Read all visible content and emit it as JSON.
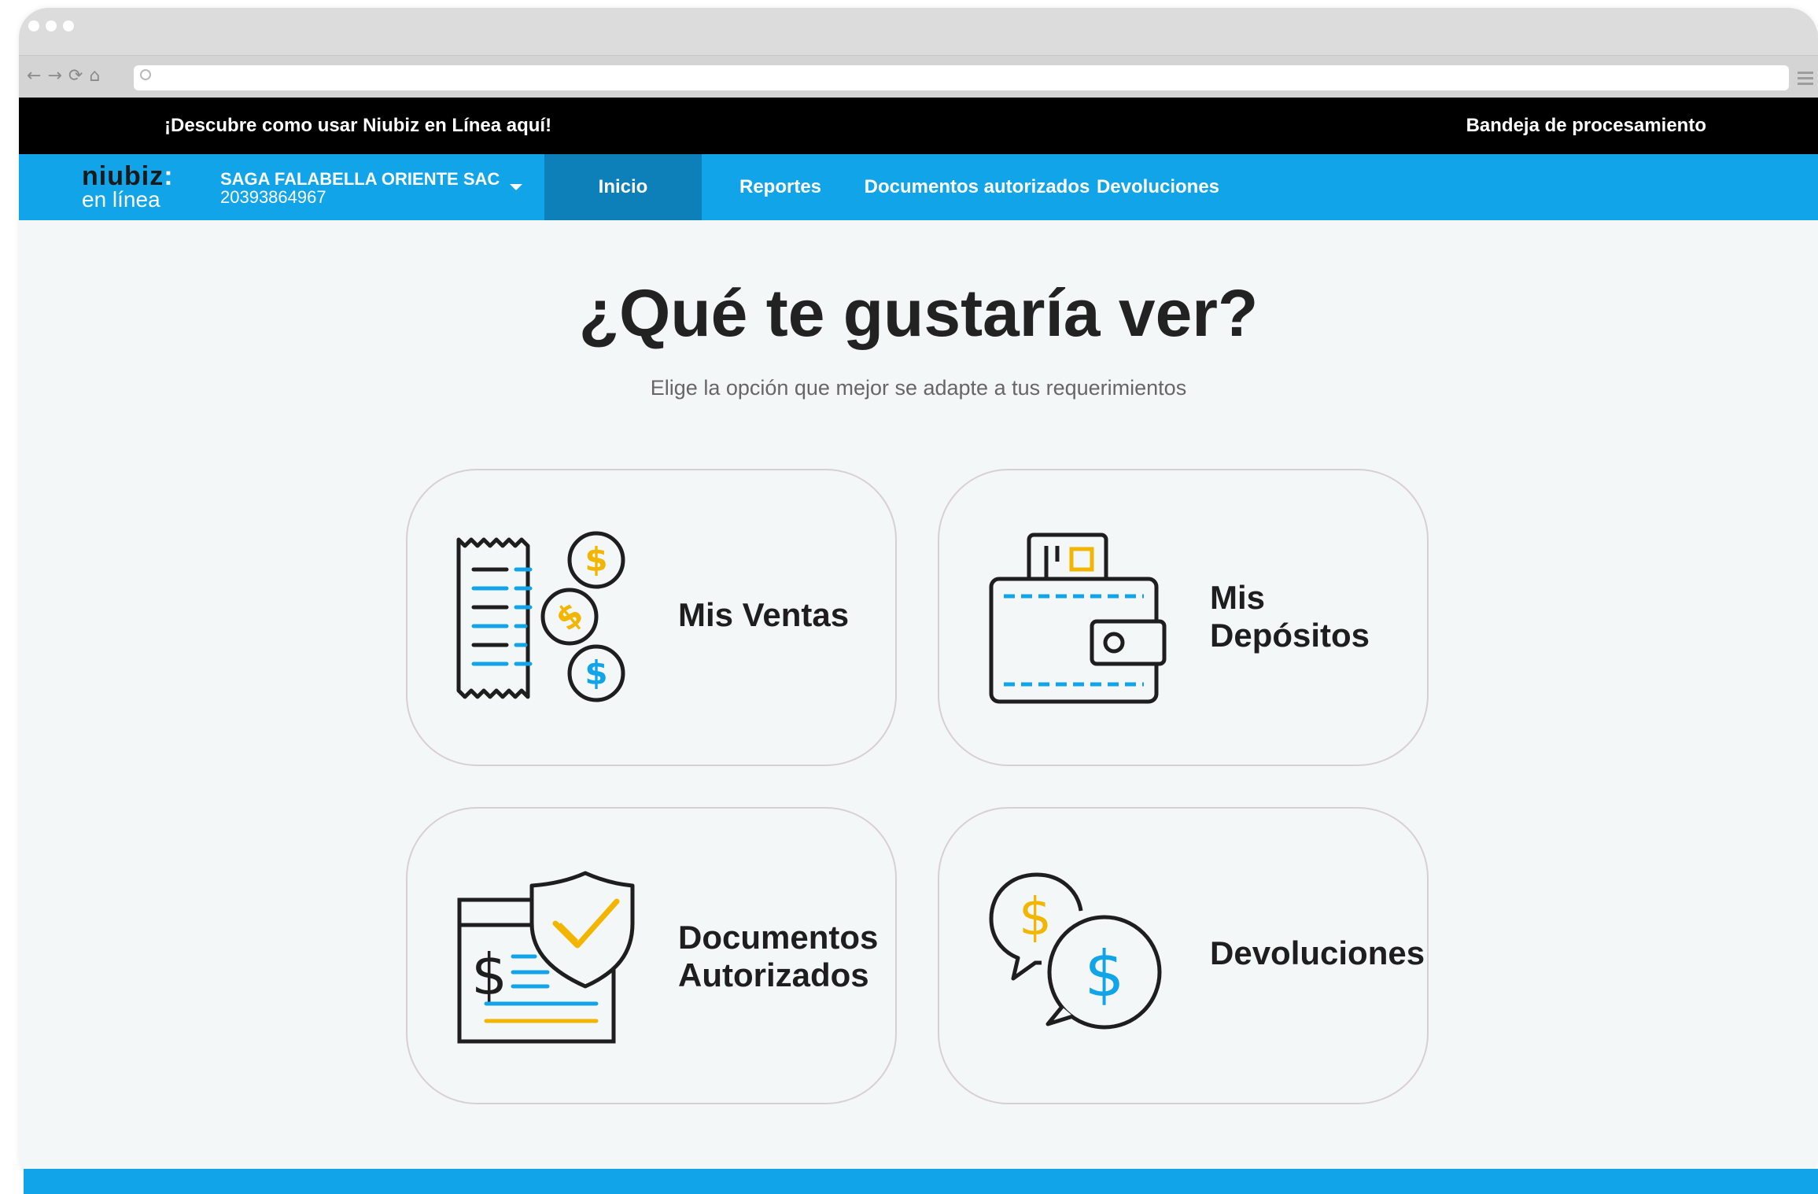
{
  "browser": {
    "nav_glyphs": [
      "←",
      "→",
      "⟳",
      "⌂"
    ]
  },
  "topbar": {
    "promo_link": "¡Descubre como usar Niubiz en Línea aquí!",
    "tray_link": "Bandeja de procesamiento"
  },
  "navbar": {
    "logo_brand": "niubiz",
    "logo_colon": ":",
    "logo_sub": "en línea",
    "company_name": "SAGA FALABELLA ORIENTE SAC",
    "company_ruc": "20393864967",
    "tabs": [
      {
        "label": "Inicio",
        "active": true
      },
      {
        "label": "Reportes",
        "active": false
      },
      {
        "label": "Documentos autorizados",
        "active": false
      },
      {
        "label": "Devoluciones",
        "active": false
      }
    ]
  },
  "main": {
    "title": "¿Qué te gustaría ver?",
    "subtitle": "Elige la opción que mejor se adapte a tus requerimientos",
    "cards": [
      {
        "line1": "Mis Ventas",
        "line2": "",
        "icon": "receipt-coins-icon"
      },
      {
        "line1": "Mis",
        "line2": "Depósitos",
        "icon": "wallet-icon"
      },
      {
        "line1": "Documentos",
        "line2": "Autorizados",
        "icon": "document-shield-icon"
      },
      {
        "line1": "Devoluciones",
        "line2": "",
        "icon": "refund-chat-icon"
      }
    ]
  },
  "colors": {
    "brand_blue": "#12a4e8",
    "active_tab": "#0d7fb9",
    "accent_yellow": "#f2b600",
    "icon_stroke": "#1e1e1e"
  }
}
